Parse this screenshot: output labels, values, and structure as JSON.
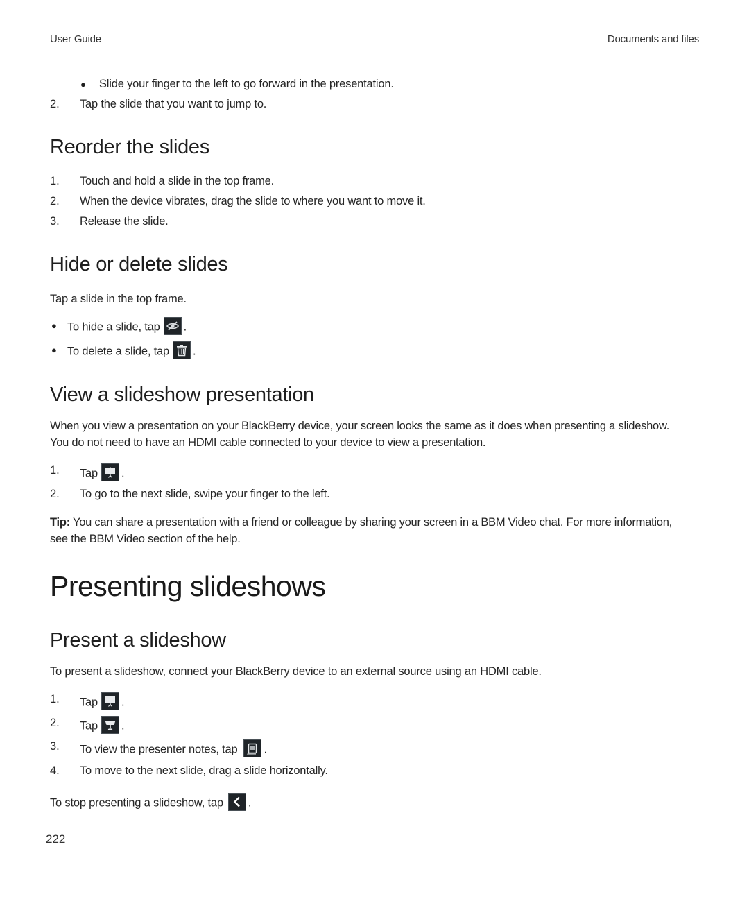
{
  "header": {
    "left": "User Guide",
    "right": "Documents and files"
  },
  "intro": {
    "bullet": "Slide your finger to the left to go forward in the presentation.",
    "step2_num": "2.",
    "step2": "Tap the slide that you want to jump to."
  },
  "reorder": {
    "title": "Reorder the slides",
    "steps": [
      {
        "num": "1.",
        "text": "Touch and hold a slide in the top frame."
      },
      {
        "num": "2.",
        "text": "When the device vibrates, drag the slide to where you want to move it."
      },
      {
        "num": "3.",
        "text": "Release the slide."
      }
    ]
  },
  "hide_delete": {
    "title": "Hide or delete slides",
    "intro": "Tap a slide in the top frame.",
    "bullets": [
      {
        "text": "To hide a slide, tap",
        "icon": "hide-eye-icon",
        "suffix": "."
      },
      {
        "text": "To delete a slide, tap",
        "icon": "trash-icon",
        "suffix": "."
      }
    ]
  },
  "view_slideshow": {
    "title": "View a slideshow presentation",
    "paragraph": "When you view a presentation on your BlackBerry device, your screen looks the same as it does when presenting a slideshow. You do not need to have an HDMI cable connected to your device to view a presentation.",
    "steps": [
      {
        "num": "1.",
        "text": "Tap",
        "icon": "presentation-screen-icon",
        "suffix": "."
      },
      {
        "num": "2.",
        "text": "To go to the next slide, swipe your finger to the left."
      }
    ],
    "tip_label": "Tip:",
    "tip_text": " You can share a presentation with a friend or colleague by sharing your screen in a BBM Video chat. For more information, see the BBM Video section of the help."
  },
  "presenting": {
    "title": "Presenting slideshows",
    "subtitle": "Present a slideshow",
    "intro": "To present a slideshow, connect your BlackBerry device to an external source using an HDMI cable.",
    "steps": [
      {
        "num": "1.",
        "text": "Tap",
        "icon": "presentation-screen-icon",
        "suffix": "."
      },
      {
        "num": "2.",
        "text": "Tap",
        "icon": "present-podium-icon",
        "suffix": "."
      },
      {
        "num": "3.",
        "text": "To view the presenter notes, tap",
        "icon": "presenter-notes-icon",
        "suffix": "."
      },
      {
        "num": "4.",
        "text": "To move to the next slide, drag a slide horizontally."
      }
    ],
    "stop_text": "To stop presenting a slideshow, tap",
    "stop_icon": "back-chevron-icon",
    "stop_suffix": "."
  },
  "footer": {
    "page_number": "222"
  }
}
